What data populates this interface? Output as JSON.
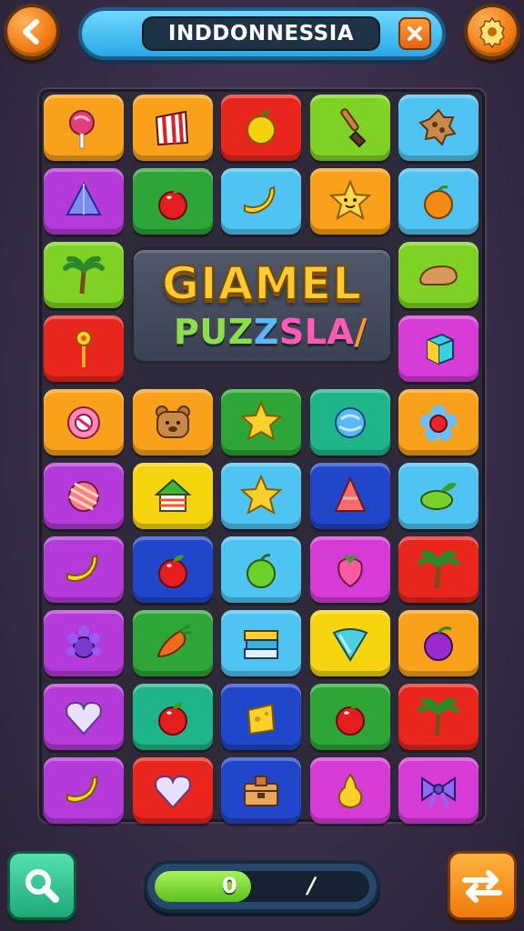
{
  "header": {
    "back_icon": "back-arrow-icon",
    "title": "INDDONNESSIA",
    "close_icon": "close-icon",
    "settings_icon": "gear-icon"
  },
  "logo": {
    "line1": "GIAMEL",
    "line2_parts": [
      "PUZ",
      "Z",
      "S",
      "LA",
      "/"
    ]
  },
  "colors": {
    "orange": "#f9a11b",
    "red": "#e8261c",
    "green": "#2ea637",
    "lime": "#7fd223",
    "sky": "#4fc3f1",
    "purple": "#b43ad9",
    "blue": "#2046c9",
    "yellow": "#f4d50e",
    "teal": "#1fb58a",
    "magenta": "#d63bd6"
  },
  "board": {
    "rows": [
      [
        {
          "c": "orange",
          "i": "lollipop-icon"
        },
        {
          "c": "orange",
          "i": "gift-box-icon"
        },
        {
          "c": "red",
          "i": "lemon-icon"
        },
        {
          "c": "lime",
          "i": "paintbrush-icon"
        },
        {
          "c": "sky",
          "i": "cookie-icon"
        }
      ],
      [
        {
          "c": "purple",
          "i": "triangle-gem-icon"
        },
        {
          "c": "green",
          "i": "apple-icon"
        },
        {
          "c": "sky",
          "i": "banana-icon"
        },
        {
          "c": "orange",
          "i": "star-face-icon"
        },
        {
          "c": "sky",
          "i": "orange-fruit-icon"
        }
      ],
      [
        {
          "c": "lime",
          "i": "palm-tree-icon"
        },
        null,
        null,
        null,
        {
          "c": "lime",
          "i": "bread-icon"
        }
      ],
      [
        {
          "c": "red",
          "i": "flower-stick-icon"
        },
        null,
        null,
        null,
        {
          "c": "magenta",
          "i": "cube-icon"
        }
      ],
      [
        {
          "c": "orange",
          "i": "candy-ball-icon"
        },
        {
          "c": "orange",
          "i": "teddy-bear-icon"
        },
        {
          "c": "green",
          "i": "star-icon"
        },
        {
          "c": "teal",
          "i": "glass-ball-icon"
        },
        {
          "c": "orange",
          "i": "flower-icon"
        }
      ],
      [
        {
          "c": "purple",
          "i": "striped-ball-icon"
        },
        {
          "c": "yellow",
          "i": "house-icon"
        },
        {
          "c": "sky",
          "i": "star-icon"
        },
        {
          "c": "blue",
          "i": "cone-icon"
        },
        {
          "c": "sky",
          "i": "leaf-fruit-icon"
        }
      ],
      [
        {
          "c": "purple",
          "i": "banana-icon"
        },
        {
          "c": "blue",
          "i": "apple-icon"
        },
        {
          "c": "sky",
          "i": "green-apple-icon"
        },
        {
          "c": "magenta",
          "i": "berry-icon"
        },
        {
          "c": "red",
          "i": "palm-tree-icon"
        }
      ],
      [
        {
          "c": "purple",
          "i": "grape-bunch-icon"
        },
        {
          "c": "green",
          "i": "carrot-icon"
        },
        {
          "c": "sky",
          "i": "books-icon"
        },
        {
          "c": "yellow",
          "i": "heart-cone-icon"
        },
        {
          "c": "orange",
          "i": "plum-icon"
        }
      ],
      [
        {
          "c": "purple",
          "i": "heart-icon"
        },
        {
          "c": "teal",
          "i": "apple-icon"
        },
        {
          "c": "blue",
          "i": "cheese-icon"
        },
        {
          "c": "green",
          "i": "apple-icon"
        },
        {
          "c": "red",
          "i": "palm-tree-icon"
        }
      ],
      [
        {
          "c": "purple",
          "i": "banana-icon"
        },
        {
          "c": "red",
          "i": "heart-icon"
        },
        {
          "c": "blue",
          "i": "chest-icon"
        },
        {
          "c": "magenta",
          "i": "pear-icon"
        },
        {
          "c": "magenta",
          "i": "bow-icon"
        }
      ]
    ]
  },
  "footer": {
    "search_icon": "magnifier-icon",
    "hint_icon": "swap-arrows-icon",
    "score_left": "0",
    "score_right": "/",
    "progress": 0.45
  }
}
